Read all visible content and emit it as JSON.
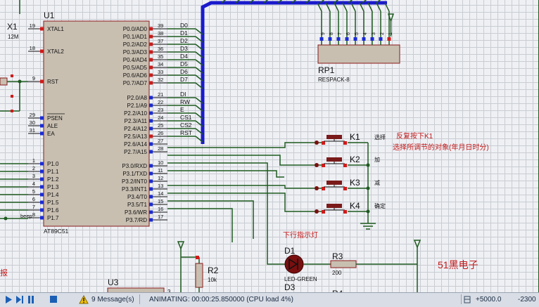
{
  "u1": {
    "ref": "U1",
    "part": "AT89C51",
    "left_pins": [
      {
        "num": "19",
        "name": "XTAL1"
      },
      {
        "num": "18",
        "name": "XTAL2"
      },
      {
        "num": "9",
        "name": "RST"
      },
      {
        "num": "29",
        "name": "PSEN"
      },
      {
        "num": "30",
        "name": "ALE"
      },
      {
        "num": "31",
        "name": "EA"
      },
      {
        "num": "1",
        "name": "P1.0"
      },
      {
        "num": "2",
        "name": "P1.1"
      },
      {
        "num": "3",
        "name": "P1.2"
      },
      {
        "num": "4",
        "name": "P1.3"
      },
      {
        "num": "5",
        "name": "P1.4"
      },
      {
        "num": "6",
        "name": "P1.5"
      },
      {
        "num": "7",
        "name": "P1.6"
      },
      {
        "num": "8",
        "name": "P1.7"
      }
    ],
    "right_pins": [
      {
        "num": "39",
        "name": "P0.0/AD0",
        "net": "D0"
      },
      {
        "num": "38",
        "name": "P0.1/AD1",
        "net": "D1"
      },
      {
        "num": "37",
        "name": "P0.2/AD2",
        "net": "D2"
      },
      {
        "num": "36",
        "name": "P0.3/AD3",
        "net": "D3"
      },
      {
        "num": "35",
        "name": "P0.4/AD4",
        "net": "D4"
      },
      {
        "num": "34",
        "name": "P0.5/AD5",
        "net": "D5"
      },
      {
        "num": "33",
        "name": "P0.6/AD6",
        "net": "D6"
      },
      {
        "num": "32",
        "name": "P0.7/AD7",
        "net": "D7"
      },
      {
        "num": "21",
        "name": "P2.0/A8",
        "net": "DI"
      },
      {
        "num": "22",
        "name": "P2.1/A9",
        "net": "RW"
      },
      {
        "num": "23",
        "name": "P2.2/A10",
        "net": "E"
      },
      {
        "num": "24",
        "name": "P2.3/A11",
        "net": "CS1"
      },
      {
        "num": "25",
        "name": "P2.4/A12",
        "net": "CS2"
      },
      {
        "num": "26",
        "name": "P2.5/A13",
        "net": "RST"
      },
      {
        "num": "27",
        "name": "P2.6/A14",
        "net": ""
      },
      {
        "num": "28",
        "name": "P2.7/A15",
        "net": ""
      },
      {
        "num": "10",
        "name": "P3.0/RXD",
        "net": ""
      },
      {
        "num": "11",
        "name": "P3.1/TXD",
        "net": ""
      },
      {
        "num": "12",
        "name": "P3.2/INT0",
        "net": ""
      },
      {
        "num": "13",
        "name": "P3.3/INT1",
        "net": ""
      },
      {
        "num": "14",
        "name": "P3.4/T0",
        "net": ""
      },
      {
        "num": "15",
        "name": "P3.5/T1",
        "net": ""
      },
      {
        "num": "16",
        "name": "P3.6/WR",
        "net": ""
      },
      {
        "num": "17",
        "name": "P3.7/RD",
        "net": ""
      }
    ],
    "beep_label": "beep"
  },
  "x1": {
    "ref": "X1",
    "value": "12M"
  },
  "rp1": {
    "ref": "RP1",
    "part": "RESPACK-8",
    "pins": [
      "9",
      "8",
      "7",
      "6",
      "5",
      "4",
      "3",
      "2",
      "1"
    ]
  },
  "keys": [
    {
      "ref": "K1",
      "label": "选择"
    },
    {
      "ref": "K2",
      "label": "加"
    },
    {
      "ref": "K3",
      "label": "减"
    },
    {
      "ref": "K4",
      "label": "确定"
    }
  ],
  "notes": {
    "k1_line1": "反复按下K1",
    "k1_line2": "选择所调节的对象(年月日时分)",
    "led_note": "下行指示灯",
    "brand": "51黑电子",
    "left_fragment": "报"
  },
  "d1": {
    "ref": "D1",
    "part": "LED-GREEN"
  },
  "d3": {
    "ref": "D3"
  },
  "r3": {
    "ref": "R3",
    "value": "200"
  },
  "r2": {
    "ref": "R2",
    "value": "10k"
  },
  "r4": {
    "ref": "R4"
  },
  "u3": {
    "ref": "U3",
    "pin": "3"
  },
  "status": {
    "messages": "9 Message(s)",
    "animating": "ANIMATING: 00:00:25.850000 (CPU load 4%)",
    "coord_x": "+5000.0",
    "coord_y": "-2300"
  },
  "colors": {
    "wire": "#1f5a1f",
    "bus": "#1a1acc",
    "component_fill": "#c8bfb1",
    "component_stroke": "#8a1a1a",
    "text_dark": "#111111",
    "note_red": "#c41a1a",
    "pin_blue": "#1b2bd6",
    "pin_red": "#d01a1a",
    "led": "#7a0f0f",
    "statusbar": "#d8dde6"
  }
}
